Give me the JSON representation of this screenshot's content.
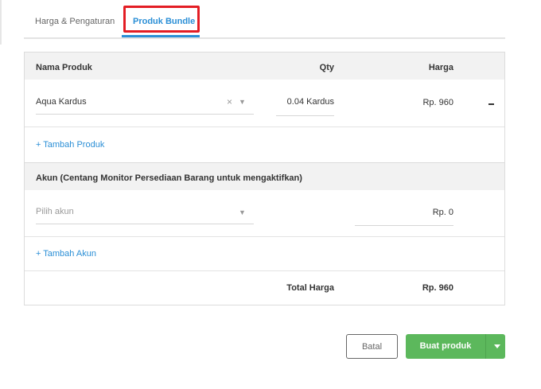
{
  "tabs": [
    {
      "label": "Harga & Pengaturan",
      "active": false
    },
    {
      "label": "Produk Bundle",
      "active": true
    }
  ],
  "colors": {
    "accent": "#2b8fd6",
    "highlight": "#e31d24",
    "primary_button": "#5cb85c"
  },
  "products": {
    "header": {
      "name": "Nama Produk",
      "qty": "Qty",
      "price": "Harga"
    },
    "rows": [
      {
        "name": "Aqua Kardus",
        "qty": "0.04 Kardus",
        "price": "Rp. 960"
      }
    ],
    "add_link": "+ Tambah Produk"
  },
  "accounts": {
    "header": "Akun (Centang Monitor Persediaan Barang untuk mengaktifkan)",
    "select_placeholder": "Pilih akun",
    "amount": "Rp. 0",
    "add_link": "+ Tambah Akun"
  },
  "total": {
    "label": "Total Harga",
    "value": "Rp. 960"
  },
  "buttons": {
    "cancel": "Batal",
    "submit": "Buat produk"
  },
  "icons": {
    "clear": "close-icon",
    "dropdown": "chevron-down-icon",
    "remove": "minus-icon"
  }
}
